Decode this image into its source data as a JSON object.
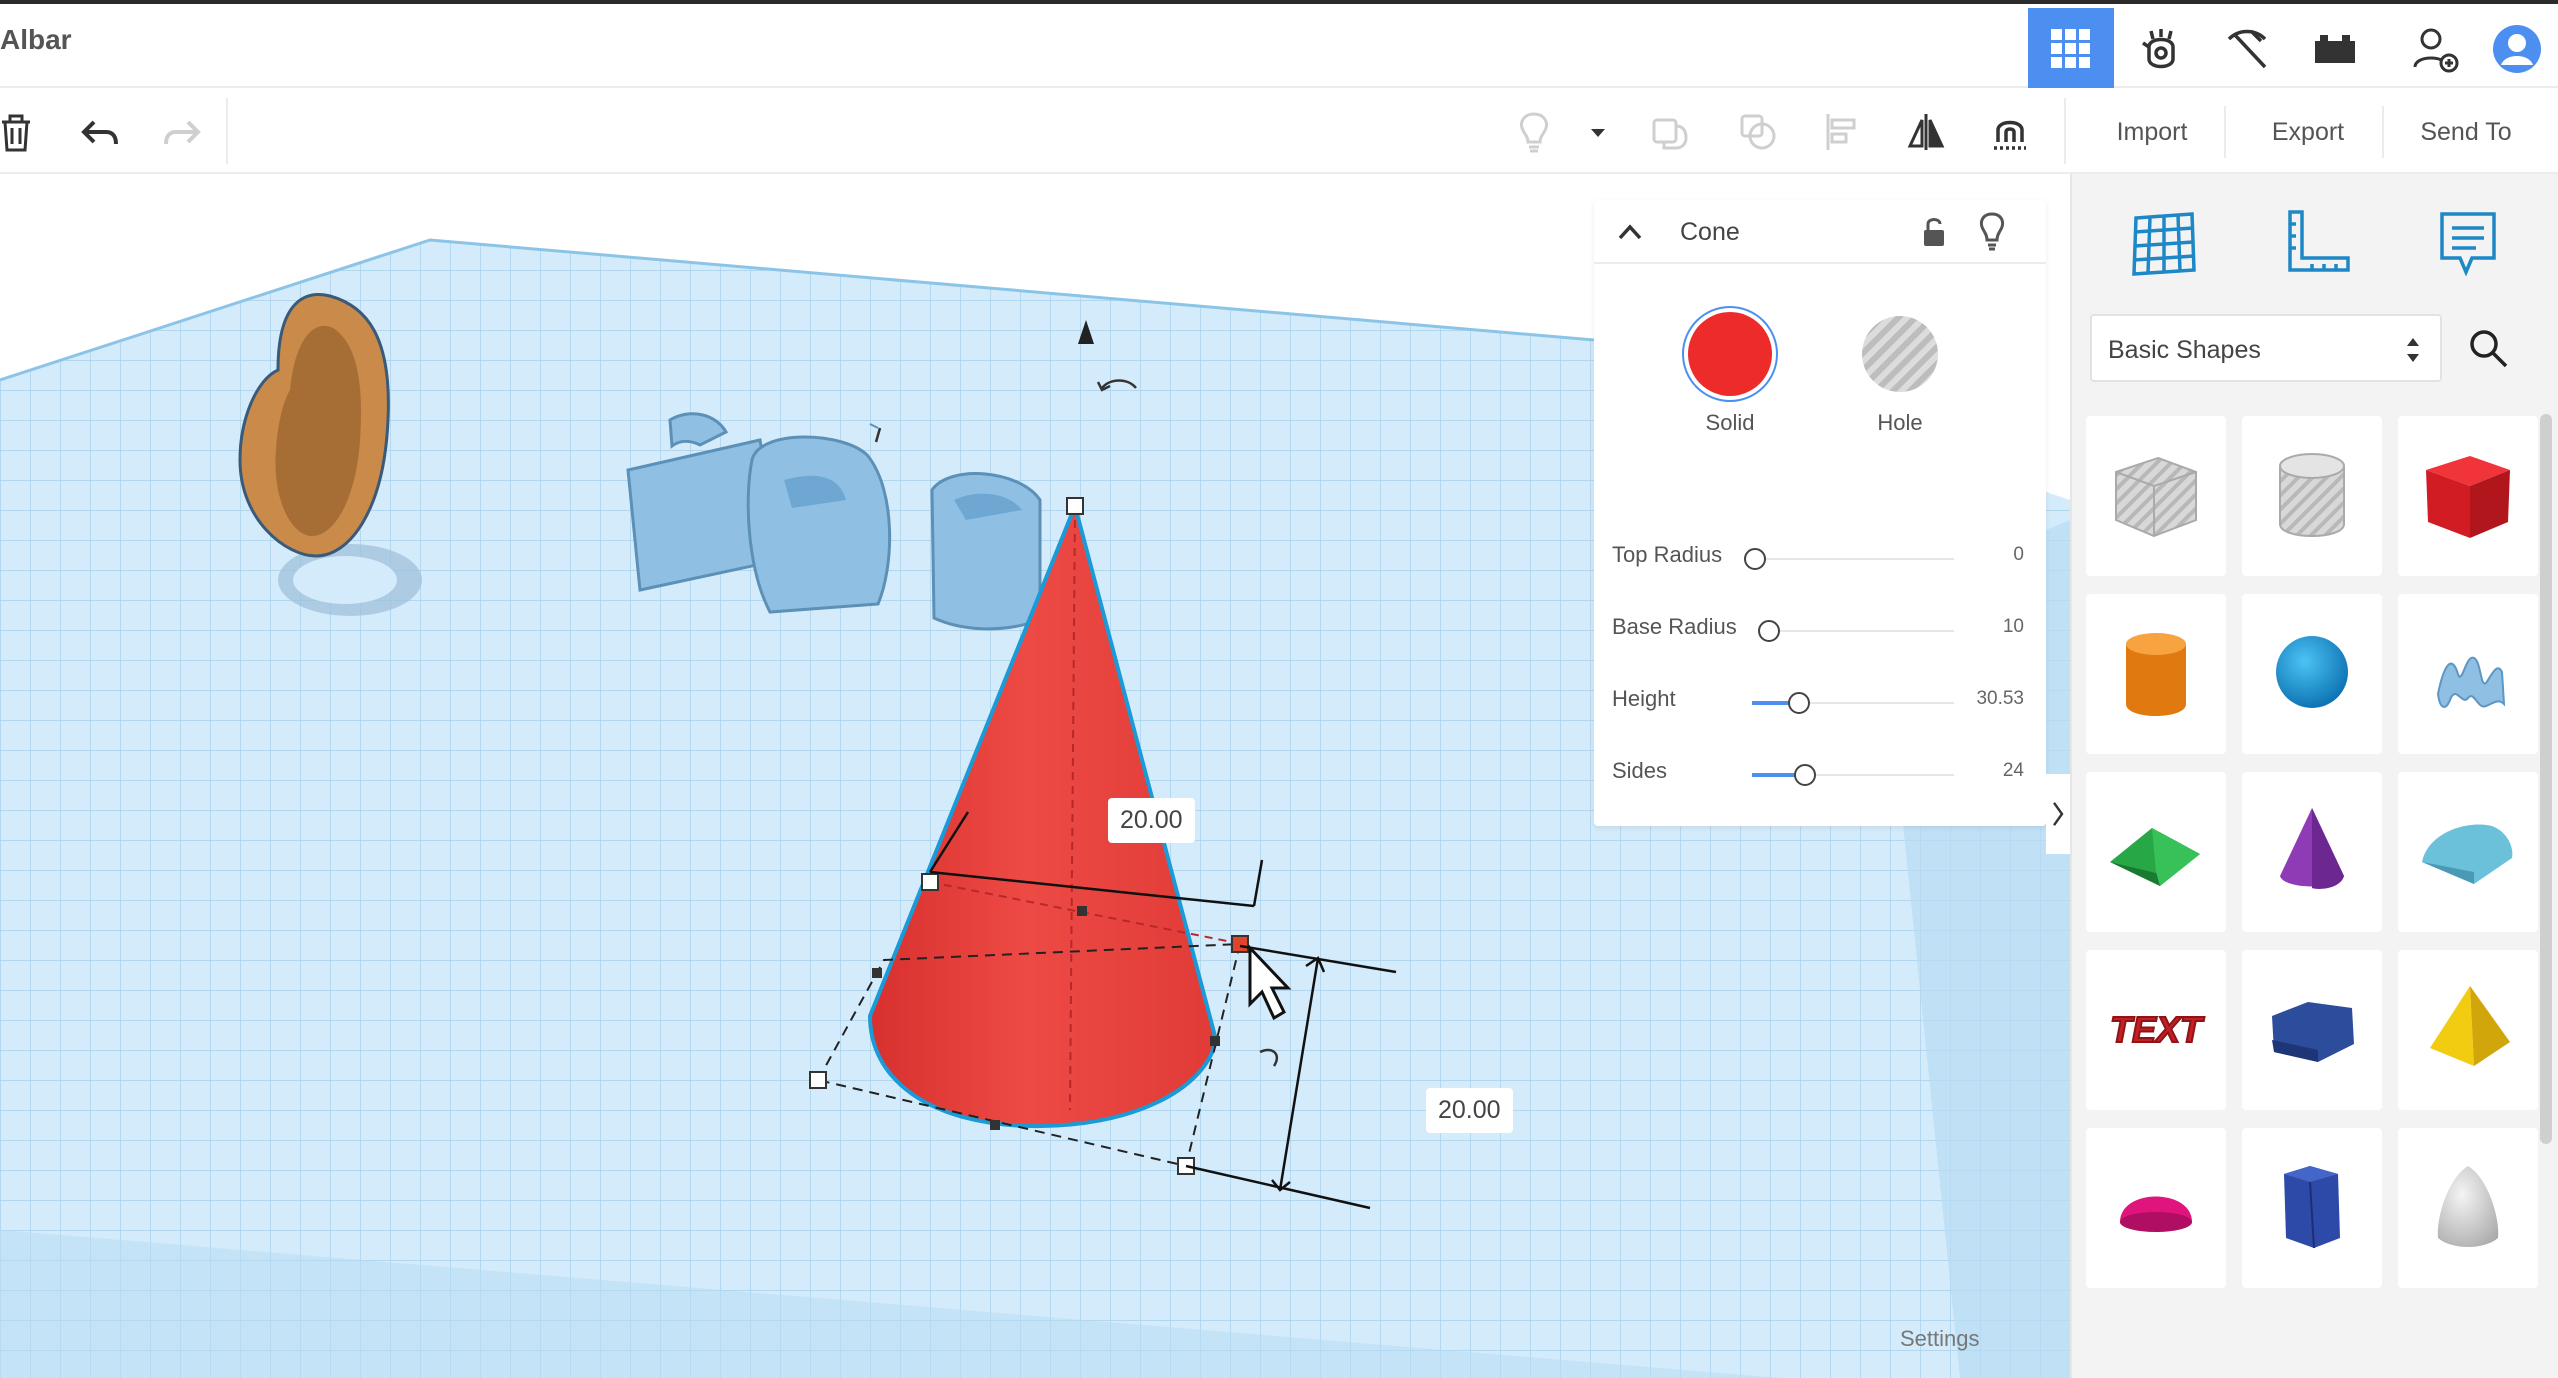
{
  "app": {
    "document_title": "Albar"
  },
  "toolbar": {
    "import_label": "Import",
    "export_label": "Export",
    "send_to_label": "Send To"
  },
  "inspector": {
    "title": "Cone",
    "materials": [
      {
        "label": "Solid",
        "color": "#ee2b2b"
      },
      {
        "label": "Hole",
        "color": "#c8c8c8"
      }
    ],
    "properties": [
      {
        "label": "Top Radius",
        "value": "0",
        "level": 0
      },
      {
        "label": "Base Radius",
        "value": "10",
        "level": 0.05
      },
      {
        "label": "Height",
        "value": "30.53",
        "level": 0.2
      },
      {
        "label": "Sides",
        "value": "24",
        "level": 0.3
      }
    ]
  },
  "dimensions": {
    "width_label": "20.00",
    "depth_label": "20.00"
  },
  "shape_panel": {
    "category": "Basic Shapes",
    "shapes": [
      {
        "name": "box-hole-shape",
        "color": "#c9c9c9"
      },
      {
        "name": "cylinder-hole-shape",
        "color": "#c9c9c9"
      },
      {
        "name": "box-shape",
        "color": "#e21f26"
      },
      {
        "name": "cylinder-shape",
        "color": "#f08a17"
      },
      {
        "name": "sphere-shape",
        "color": "#1593d6"
      },
      {
        "name": "scribble-shape",
        "color": "#86b6d9"
      },
      {
        "name": "roof-shape",
        "color": "#27a745"
      },
      {
        "name": "cone-shape",
        "color": "#8e3bb5"
      },
      {
        "name": "round-roof-shape",
        "color": "#6cc1da"
      },
      {
        "name": "text-shape",
        "color": "#c51f24"
      },
      {
        "name": "polygon-shape",
        "color": "#2c4c9c"
      },
      {
        "name": "pyramid-shape",
        "color": "#f2cc10"
      },
      {
        "name": "half-sphere-shape",
        "color": "#e0147d"
      },
      {
        "name": "hexagonal-prism-shape",
        "color": "#2e4aa8"
      },
      {
        "name": "paraboloid-shape",
        "color": "#d6d6d6"
      }
    ]
  },
  "footer": {
    "settings_label": "Settings"
  },
  "colors": {
    "accent": "#4d8ff0",
    "grid": "#bfe1f7",
    "cone": "#e8403d"
  }
}
